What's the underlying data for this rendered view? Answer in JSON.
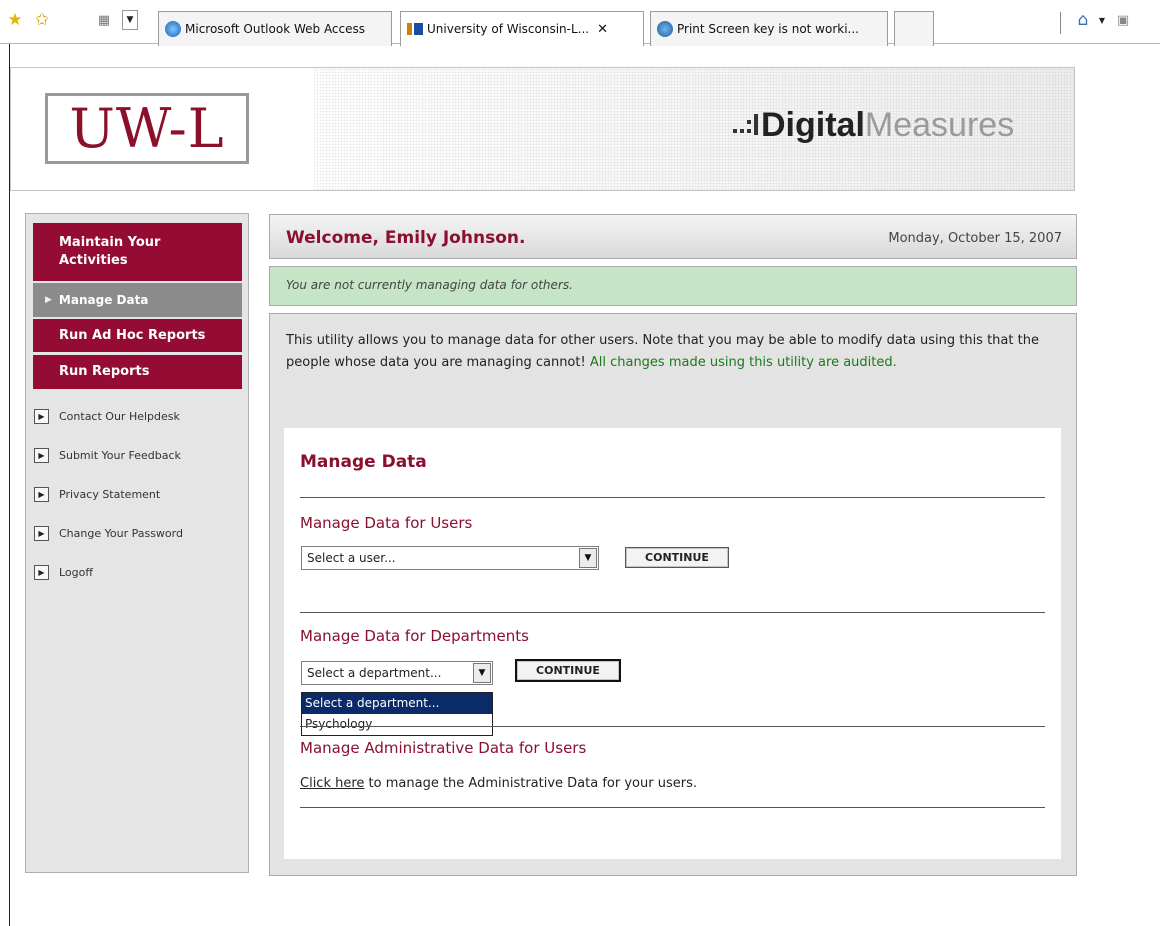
{
  "browser": {
    "tabs": [
      {
        "label": "Microsoft Outlook Web Access",
        "active": false
      },
      {
        "label": "University of Wisconsin-L...",
        "active": true
      },
      {
        "label": "Print Screen key is not worki...",
        "active": false
      },
      {
        "label": "",
        "active": false
      }
    ]
  },
  "header": {
    "logo": "UW-L",
    "brand_bold": "Digital",
    "brand_light": "Measures"
  },
  "sidebar": {
    "buttons": [
      {
        "label": "Maintain Your Activities"
      },
      {
        "label": "Manage Data"
      },
      {
        "label": "Run Ad Hoc Reports"
      },
      {
        "label": "Run Reports"
      }
    ],
    "links": [
      {
        "label": "Contact Our Helpdesk"
      },
      {
        "label": "Submit Your Feedback"
      },
      {
        "label": "Privacy Statement"
      },
      {
        "label": "Change Your Password"
      },
      {
        "label": "Logoff"
      }
    ]
  },
  "welcome": {
    "title": "Welcome, Emily Johnson.",
    "date": "Monday, October 15, 2007"
  },
  "notice": "You are not currently managing data for others.",
  "intro": {
    "text": "This utility allows you to manage data for other users. Note that you may be able to modify data using this that the people whose data you are managing cannot!",
    "warning": "All changes made using this utility are audited."
  },
  "manage": {
    "title": "Manage Data",
    "users": {
      "heading": "Manage Data for Users",
      "select_value": "Select a user...",
      "button": "CONTINUE"
    },
    "departments": {
      "heading": "Manage Data for Departments",
      "select_value": "Select a department...",
      "button": "CONTINUE",
      "options": [
        "Select a department...",
        "Psychology"
      ]
    },
    "admin": {
      "heading": "Manage Administrative Data for Users",
      "link": "Click here",
      "text": "to manage the Administrative Data for your users."
    }
  }
}
